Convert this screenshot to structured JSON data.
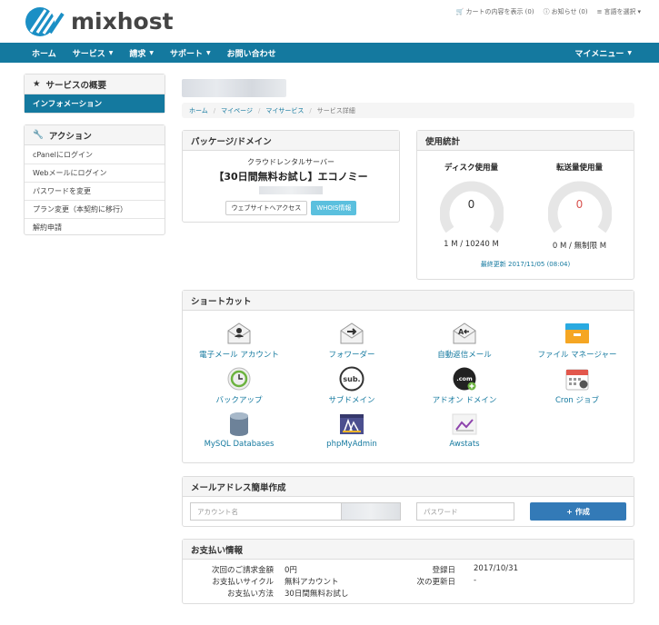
{
  "brand": {
    "logo_text": "mixhost"
  },
  "top_links": {
    "cart": "カートの内容を表示 (0)",
    "notices": "お知らせ (0)",
    "language": "言語を選択"
  },
  "nav": {
    "items": [
      {
        "label": "ホーム",
        "caret": false
      },
      {
        "label": "サービス",
        "caret": true
      },
      {
        "label": "請求",
        "caret": true
      },
      {
        "label": "サポート",
        "caret": true
      },
      {
        "label": "お問い合わせ",
        "caret": false
      }
    ],
    "my_menu": "マイメニュー"
  },
  "sidebar": {
    "overview": {
      "title": "サービスの概要",
      "active_item": "インフォメーション"
    },
    "actions": {
      "title": "アクション",
      "items": [
        "cPanelにログイン",
        "Webメールにログイン",
        "パスワードを変更",
        "プラン変更（本契約に移行）",
        "解約申請"
      ]
    }
  },
  "breadcrumb": {
    "home": "ホーム",
    "mypage": "マイページ",
    "myservice": "マイサービス",
    "current": "サービス詳細"
  },
  "package": {
    "title": "パッケージ/ドメイン",
    "subtitle": "クラウドレンタルサーバー",
    "name": "【30日間無料お試し】エコノミー",
    "visit_button": "ウェブサイトへアクセス",
    "whois_button": "WHOIS情報"
  },
  "usage": {
    "title": "使用統計",
    "disk": {
      "label": "ディスク使用量",
      "value": "0",
      "amount": "1 M / 10240 M",
      "fraction": 0.0
    },
    "bandwidth": {
      "label": "転送量使用量",
      "value": "0",
      "amount": "0 M / 無制限 M",
      "fraction": 0.0
    },
    "last_update": "最終更新 2017/11/05 (08:04)",
    "colors": {
      "disk_value": "#333333",
      "bandwidth_value": "#d9534f",
      "gauge_track": "#e6e6e6"
    }
  },
  "shortcuts": {
    "title": "ショートカット",
    "items": [
      {
        "label": "電子メール アカウント",
        "icon": "email-accounts-icon"
      },
      {
        "label": "フォワーダー",
        "icon": "forwarders-icon"
      },
      {
        "label": "自動返信メール",
        "icon": "autoresponders-icon"
      },
      {
        "label": "ファイル マネージャー",
        "icon": "file-manager-icon"
      },
      {
        "label": "バックアップ",
        "icon": "backup-icon"
      },
      {
        "label": "サブドメイン",
        "icon": "subdomains-icon"
      },
      {
        "label": "アドオン ドメイン",
        "icon": "addon-domains-icon"
      },
      {
        "label": "Cron ジョブ",
        "icon": "cron-jobs-icon"
      },
      {
        "label": "MySQL Databases",
        "icon": "mysql-databases-icon"
      },
      {
        "label": "phpMyAdmin",
        "icon": "phpmyadmin-icon"
      },
      {
        "label": "Awstats",
        "icon": "awstats-icon"
      }
    ]
  },
  "mail_create": {
    "title": "メールアドレス簡単作成",
    "account_placeholder": "アカウント名",
    "password_placeholder": "パスワード",
    "create_button": "作成"
  },
  "payment": {
    "title": "お支払い情報",
    "next_amount_label": "次回のご請求金額",
    "next_amount": "0円",
    "cycle_label": "お支払いサイクル",
    "cycle": "無料アカウント",
    "method_label": "お支払い方法",
    "method": "30日間無料お試し",
    "reg_date_label": "登録日",
    "reg_date": "2017/10/31",
    "next_due_label": "次の更新日",
    "next_due": "-"
  }
}
